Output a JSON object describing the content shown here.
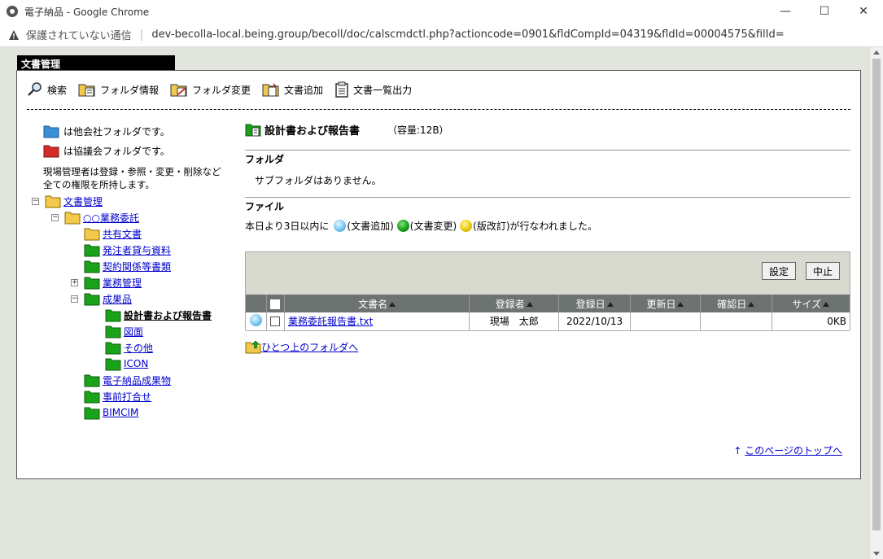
{
  "window": {
    "title": "電子納品 - Google Chrome",
    "controls": [
      "—",
      "☐",
      "✕"
    ]
  },
  "address": {
    "insecure_label": "保護されていない通信",
    "url": "dev-becolla-local.being.group/becoll/doc/calscmdctl.php?actioncode=0901&fldCompId=04319&fldId=00004575&filId="
  },
  "panel": {
    "tab_title": "文書管理"
  },
  "toolbar": {
    "items": [
      {
        "label": "検索",
        "icon": "magnifier-icon"
      },
      {
        "label": "フォルダ情報",
        "icon": "folder-info-icon"
      },
      {
        "label": "フォルダ変更",
        "icon": "folder-edit-icon"
      },
      {
        "label": "文書追加",
        "icon": "document-add-icon"
      },
      {
        "label": "文書一覧出力",
        "icon": "document-list-icon"
      }
    ]
  },
  "legend": {
    "other_company": "は他会社フォルダです。",
    "council": "は協議会フォルダです。",
    "note_line1": "現場管理者は登録・参照・変更・削除など",
    "note_line2": "全ての権限を所持します。",
    "colors": {
      "other_company": "#3a8fd6",
      "council": "#d62b2b"
    }
  },
  "tree": {
    "nodes": [
      {
        "label": "文書管理",
        "toggle": "−"
      },
      {
        "label": "○○業務委託",
        "toggle": "−"
      },
      {
        "label": "共有文書",
        "toggle": ""
      },
      {
        "label": "発注者貸与資料",
        "toggle": ""
      },
      {
        "label": "契約関係等書類",
        "toggle": ""
      },
      {
        "label": "業務管理",
        "toggle": "+"
      },
      {
        "label": "成果品",
        "toggle": "−"
      },
      {
        "label": "設計書および報告書",
        "toggle": ""
      },
      {
        "label": "図面",
        "toggle": ""
      },
      {
        "label": "その他",
        "toggle": ""
      },
      {
        "label": "ICON",
        "toggle": ""
      },
      {
        "label": "電子納品成果物",
        "toggle": ""
      },
      {
        "label": "事前打合せ",
        "toggle": ""
      },
      {
        "label": "BIMCIM",
        "toggle": ""
      }
    ]
  },
  "main": {
    "folder_title": "設計書および報告書",
    "capacity": "（容量:12B）",
    "folder_section": "フォルダ",
    "no_subfolder": "サブフォルダはありません。",
    "file_section": "ファイル",
    "notice_prefix": "本日より3日以内に",
    "notice_add": "(文書追加)",
    "notice_change": "(文書変更)",
    "notice_revise": "(版改訂)が行なわれました。",
    "btn_settings": "設定",
    "btn_stop": "中止",
    "columns": [
      "文書名",
      "登録者",
      "登録日",
      "更新日",
      "確認日",
      "サイズ"
    ],
    "rows": [
      {
        "name": "業務委託報告書.txt",
        "registrant": "現場　太郎",
        "registered": "2022/10/13",
        "updated": "",
        "confirmed": "",
        "size": "0KB"
      }
    ],
    "up_link": "ひとつ上のフォルダへ",
    "top_link": "このページのトップへ"
  }
}
